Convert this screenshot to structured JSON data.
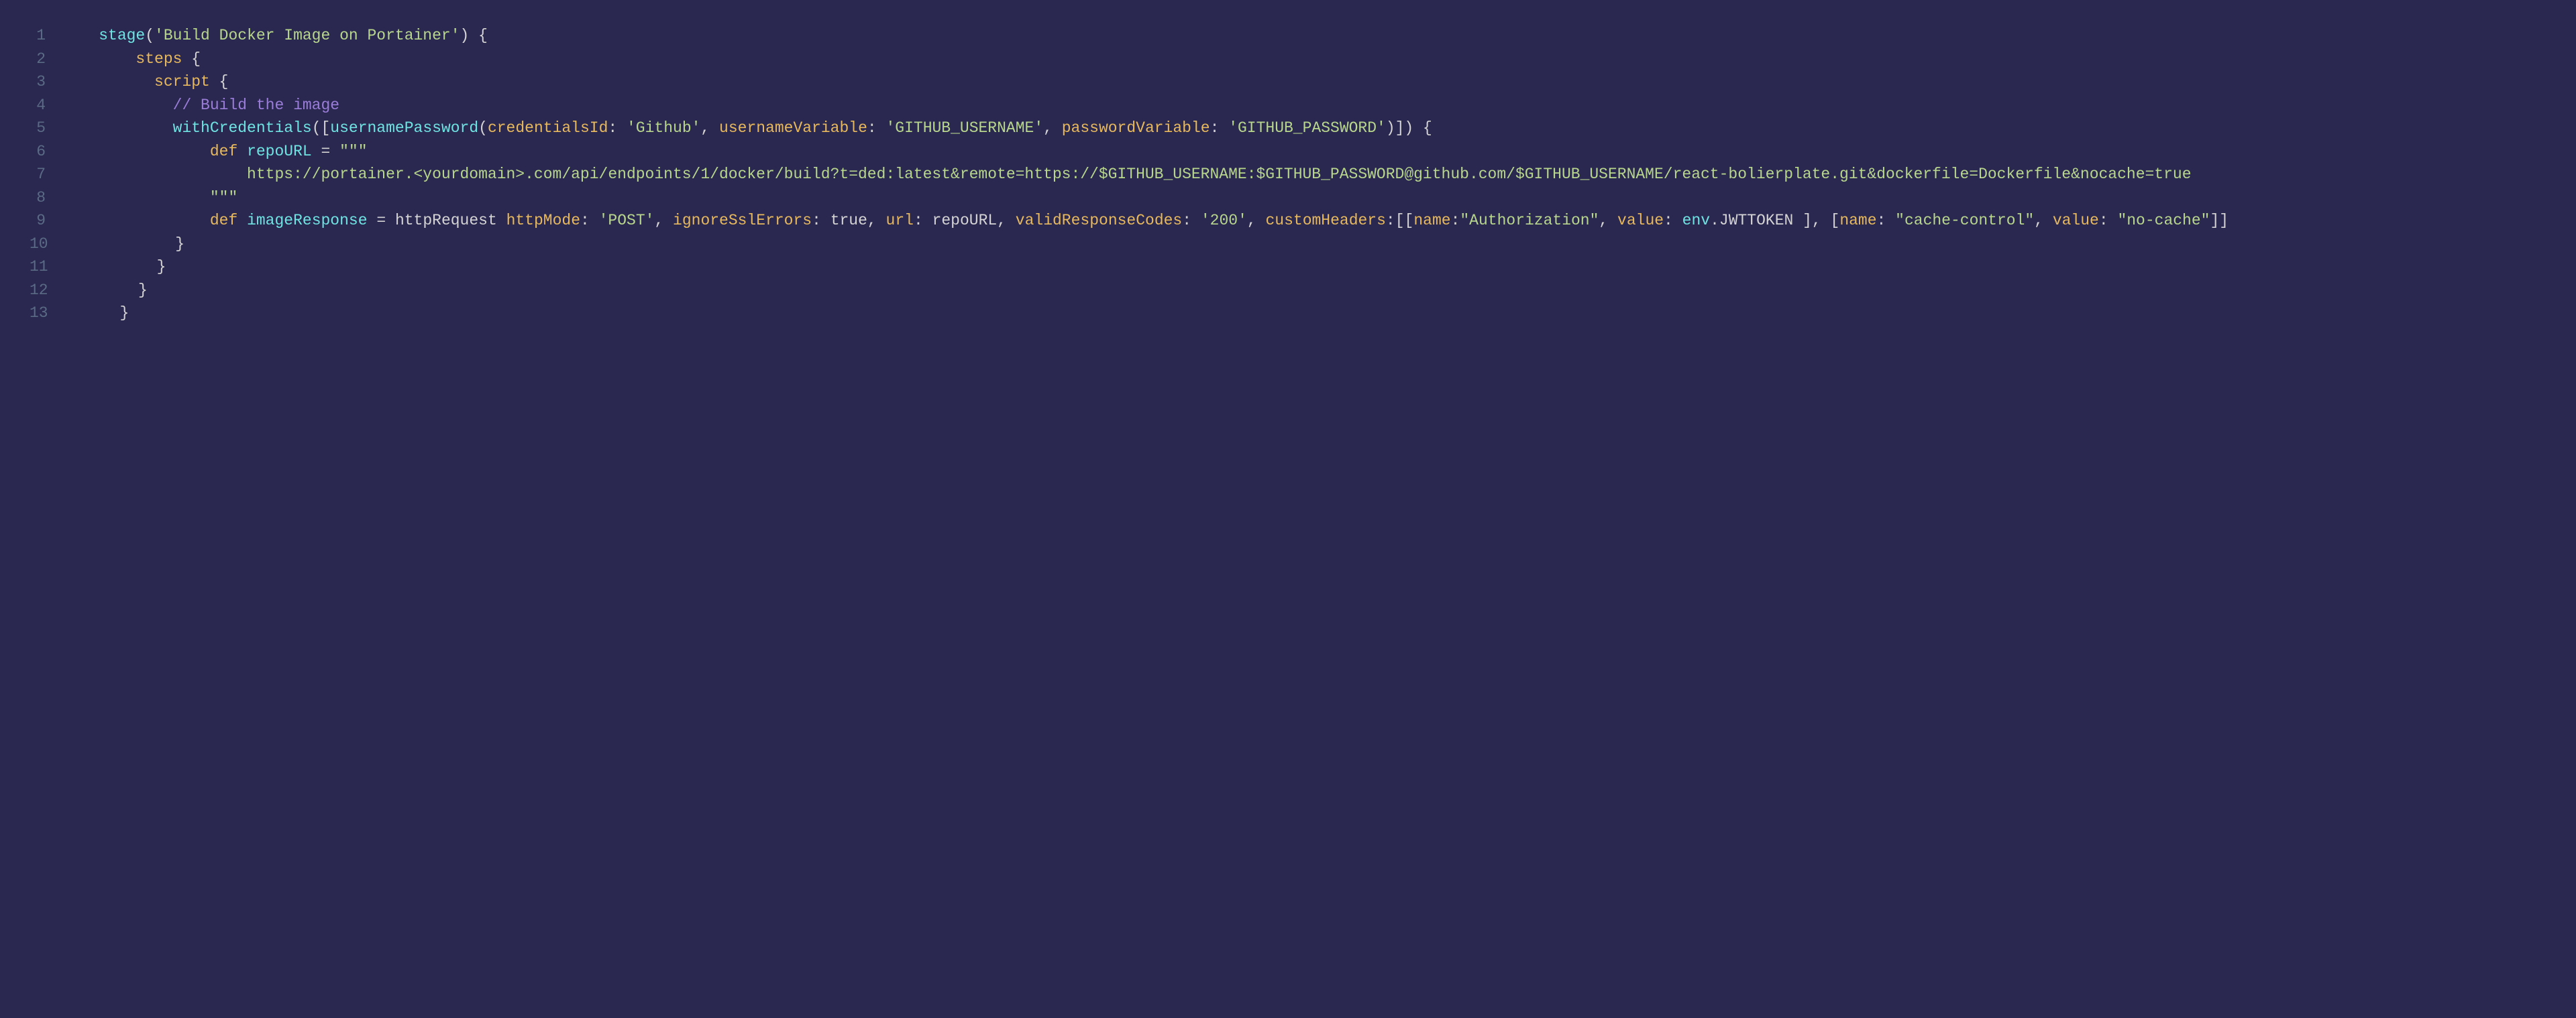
{
  "lines": [
    {
      "n": "1",
      "segments": [
        {
          "t": "    ",
          "c": ""
        },
        {
          "t": "stage",
          "c": "fn"
        },
        {
          "t": "(",
          "c": "punct"
        },
        {
          "t": "'Build Docker Image on Portainer'",
          "c": "str"
        },
        {
          "t": ") {",
          "c": "punct"
        }
      ]
    },
    {
      "n": "2",
      "segments": [
        {
          "t": "        ",
          "c": ""
        },
        {
          "t": "steps",
          "c": "type"
        },
        {
          "t": " {",
          "c": "punct"
        }
      ]
    },
    {
      "n": "3",
      "segments": [
        {
          "t": "          ",
          "c": ""
        },
        {
          "t": "script",
          "c": "type"
        },
        {
          "t": " {",
          "c": "punct"
        }
      ]
    },
    {
      "n": "4",
      "segments": [
        {
          "t": "            ",
          "c": ""
        },
        {
          "t": "// Build the image",
          "c": "comment"
        }
      ]
    },
    {
      "n": "5",
      "segments": [
        {
          "t": "            ",
          "c": ""
        },
        {
          "t": "withCredentials",
          "c": "fn"
        },
        {
          "t": "([",
          "c": "punct"
        },
        {
          "t": "usernamePassword",
          "c": "fn"
        },
        {
          "t": "(",
          "c": "punct"
        },
        {
          "t": "credentialsId",
          "c": "kw"
        },
        {
          "t": ": ",
          "c": "punct"
        },
        {
          "t": "'Github'",
          "c": "str"
        },
        {
          "t": ", ",
          "c": "punct"
        },
        {
          "t": "usernameVariable",
          "c": "kw"
        },
        {
          "t": ": ",
          "c": "punct"
        },
        {
          "t": "'GITHUB_USERNAME'",
          "c": "str"
        },
        {
          "t": ", ",
          "c": "punct"
        },
        {
          "t": "passwordVariable",
          "c": "kw"
        },
        {
          "t": ": ",
          "c": "punct"
        },
        {
          "t": "'GITHUB_PASSWORD'",
          "c": "str"
        },
        {
          "t": ")]) {",
          "c": "punct"
        }
      ]
    },
    {
      "n": "6",
      "segments": [
        {
          "t": "                ",
          "c": ""
        },
        {
          "t": "def",
          "c": "kw"
        },
        {
          "t": " ",
          "c": ""
        },
        {
          "t": "repoURL",
          "c": "prop"
        },
        {
          "t": " = ",
          "c": "punct"
        },
        {
          "t": "\"\"\"",
          "c": "str"
        }
      ]
    },
    {
      "n": "7",
      "segments": [
        {
          "t": "                    ",
          "c": ""
        },
        {
          "t": "https://portainer.<yourdomain>.com/api/endpoints/1/docker/build?t=ded:latest&remote=https://$GITHUB_USERNAME:$GITHUB_PASSWORD@github.com/$GITHUB_USERNAME/react-bolierplate.git&dockerfile=Dockerfile&nocache=true",
          "c": "str"
        }
      ]
    },
    {
      "n": "8",
      "segments": [
        {
          "t": "                ",
          "c": ""
        },
        {
          "t": "\"\"\"",
          "c": "str"
        }
      ]
    },
    {
      "n": "9",
      "segments": [
        {
          "t": "                ",
          "c": ""
        },
        {
          "t": "def",
          "c": "kw"
        },
        {
          "t": " ",
          "c": ""
        },
        {
          "t": "imageResponse",
          "c": "prop"
        },
        {
          "t": " = ",
          "c": "punct"
        },
        {
          "t": "httpRequest",
          "c": "ident"
        },
        {
          "t": " ",
          "c": ""
        },
        {
          "t": "httpMode",
          "c": "kw"
        },
        {
          "t": ": ",
          "c": "punct"
        },
        {
          "t": "'POST'",
          "c": "str"
        },
        {
          "t": ", ",
          "c": "punct"
        },
        {
          "t": "ignoreSslErrors",
          "c": "kw"
        },
        {
          "t": ": ",
          "c": "punct"
        },
        {
          "t": "true",
          "c": "bool"
        },
        {
          "t": ", ",
          "c": "punct"
        },
        {
          "t": "url",
          "c": "kw"
        },
        {
          "t": ": ",
          "c": "punct"
        },
        {
          "t": "repoURL",
          "c": "ident"
        },
        {
          "t": ", ",
          "c": "punct"
        },
        {
          "t": "validResponseCodes",
          "c": "kw"
        },
        {
          "t": ": ",
          "c": "punct"
        },
        {
          "t": "'200'",
          "c": "str"
        },
        {
          "t": ", ",
          "c": "punct"
        },
        {
          "t": "customHeaders",
          "c": "kw"
        },
        {
          "t": ":[[",
          "c": "punct"
        },
        {
          "t": "name",
          "c": "kw"
        },
        {
          "t": ":",
          "c": "punct"
        },
        {
          "t": "\"Authorization\"",
          "c": "str"
        },
        {
          "t": ", ",
          "c": "punct"
        },
        {
          "t": "value",
          "c": "kw"
        },
        {
          "t": ": ",
          "c": "punct"
        },
        {
          "t": "env",
          "c": "prop"
        },
        {
          "t": ".",
          "c": "punct"
        },
        {
          "t": "JWTTOKEN",
          "c": "ident"
        },
        {
          "t": " ], [",
          "c": "punct"
        },
        {
          "t": "name",
          "c": "kw"
        },
        {
          "t": ": ",
          "c": "punct"
        },
        {
          "t": "\"cache-control\"",
          "c": "str"
        },
        {
          "t": ", ",
          "c": "punct"
        },
        {
          "t": "value",
          "c": "kw"
        },
        {
          "t": ": ",
          "c": "punct"
        },
        {
          "t": "\"no-cache\"",
          "c": "str"
        },
        {
          "t": "]]",
          "c": "punct"
        }
      ]
    },
    {
      "n": "10",
      "segments": [
        {
          "t": "            }",
          "c": "punct"
        }
      ]
    },
    {
      "n": "11",
      "segments": [
        {
          "t": "          }",
          "c": "punct"
        }
      ]
    },
    {
      "n": "12",
      "segments": [
        {
          "t": "        }",
          "c": "punct"
        }
      ]
    },
    {
      "n": "13",
      "segments": [
        {
          "t": "      }",
          "c": "punct"
        }
      ]
    }
  ]
}
